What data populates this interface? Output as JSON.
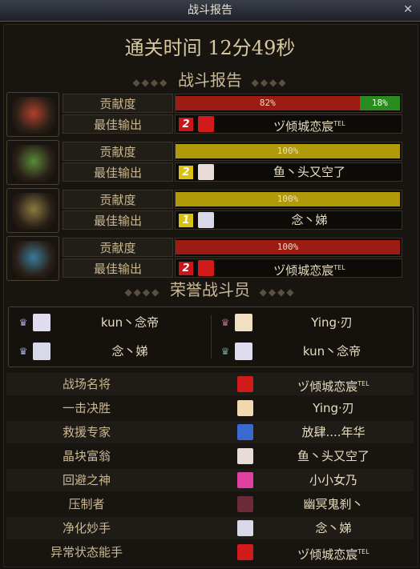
{
  "window": {
    "title": "战斗报告",
    "close_icon": "close-icon"
  },
  "clear_time": "通关时间 12分49秒",
  "battle_report": {
    "title": "战斗报告",
    "teams": [
      {
        "emblem": "flame-crest-icon",
        "emblem_color": "#b0402a",
        "contribution_label": "贡献度",
        "best_label": "最佳输出",
        "bar_color": "#9c1c14",
        "contribution": 82,
        "contribution_text": "82%",
        "secondary": 18,
        "secondary_text": "18%",
        "rank": "2",
        "rank_color": "#c8161a",
        "avatar_color": "#d11a1a",
        "player": "ヅ倾城恋宸",
        "player_sup": "TEL"
      },
      {
        "emblem": "green-crest-icon",
        "emblem_color": "#5a8a3a",
        "contribution_label": "贡献度",
        "best_label": "最佳输出",
        "bar_color": "#b09a0a",
        "contribution": 100,
        "contribution_text": "100%",
        "rank": "2",
        "rank_color": "#d8c010",
        "avatar_color": "#e8dcd8",
        "player": "鱼丶头又空了",
        "player_sup": ""
      },
      {
        "emblem": "gold-crest-icon",
        "emblem_color": "#8a7a40",
        "contribution_label": "贡献度",
        "best_label": "最佳输出",
        "bar_color": "#b09a0a",
        "contribution": 100,
        "contribution_text": "100%",
        "rank": "1",
        "rank_color": "#d8c010",
        "avatar_color": "#d8d8e8",
        "player": "念丶娣",
        "player_sup": ""
      },
      {
        "emblem": "blue-crest-icon",
        "emblem_color": "#3a7a9a",
        "contribution_label": "贡献度",
        "best_label": "最佳输出",
        "bar_color": "#9c1c14",
        "contribution": 100,
        "contribution_text": "100%",
        "rank": "2",
        "rank_color": "#c8161a",
        "avatar_color": "#d11a1a",
        "player": "ヅ倾城恋宸",
        "player_sup": "TEL"
      }
    ]
  },
  "honor": {
    "title": "荣誉战斗员",
    "players": [
      {
        "medal": "♛",
        "medal_color": "#b8a0e0",
        "avatar_color": "#e0dcf0",
        "name": "kun丶念帝"
      },
      {
        "medal": "♛",
        "medal_color": "#b07090",
        "avatar_color": "#f0e0c0",
        "name": "Ying·刃"
      },
      {
        "medal": "♛",
        "medal_color": "#a0b0d0",
        "avatar_color": "#d8d8e8",
        "name": "念丶娣"
      },
      {
        "medal": "♛",
        "medal_color": "#70a090",
        "avatar_color": "#e0dcf0",
        "name": "kun丶念帝"
      }
    ]
  },
  "awards": [
    {
      "title": "战场名将",
      "avatar_color": "#d11a1a",
      "name": "ヅ倾城恋宸",
      "sup": "TEL"
    },
    {
      "title": "一击决胜",
      "avatar_color": "#f0d8b0",
      "name": "Ying·刃",
      "sup": ""
    },
    {
      "title": "救援专家",
      "avatar_color": "#3a6ad0",
      "name": "放肆....年华",
      "sup": ""
    },
    {
      "title": "晶块富翁",
      "avatar_color": "#e8dcd8",
      "name": "鱼丶头又空了",
      "sup": ""
    },
    {
      "title": "回避之神",
      "avatar_color": "#e040a0",
      "name": "小小女乃",
      "sup": ""
    },
    {
      "title": "压制者",
      "avatar_color": "#6a2a3a",
      "name": "幽冥鬼刹丶",
      "sup": ""
    },
    {
      "title": "净化妙手",
      "avatar_color": "#d8d8e8",
      "name": "念丶娣",
      "sup": ""
    },
    {
      "title": "异常状态能手",
      "avatar_color": "#d11a1a",
      "name": "ヅ倾城恋宸",
      "sup": "TEL"
    }
  ]
}
